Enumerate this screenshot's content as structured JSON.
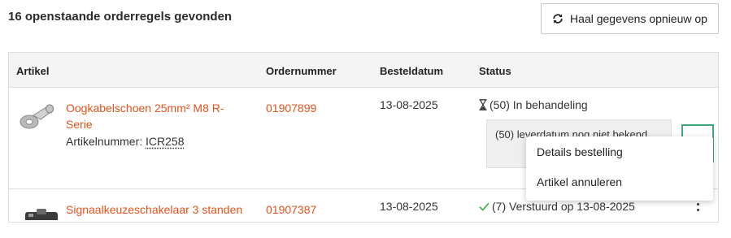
{
  "header": {
    "title": "16 openstaande orderregels gevonden",
    "refresh_label": "Haal gegevens opnieuw op"
  },
  "table": {
    "columns": [
      "Artikel",
      "Ordernummer",
      "Besteldatum",
      "Status"
    ],
    "rows": [
      {
        "product": "Oogkabelschoen 25mm² M8 R-Serie",
        "article_prefix": "Artikelnummer: ",
        "article_code": "ICR258",
        "order_number": "01907899",
        "order_date": "13-08-2025",
        "status": "(50) In behandeling",
        "status_icon": "hourglass-icon",
        "tooltip": "(50) leverdatum nog niet bekend"
      },
      {
        "product": "Signaalkeuzeschakelaar 3 standen",
        "order_number": "01907387",
        "order_date": "13-08-2025",
        "status": "(7) Verstuurd op 13-08-2025",
        "status_icon": "checkmark-icon",
        "status_icon_color": "#4caf50"
      }
    ]
  },
  "menu": {
    "items": [
      "Details bestelling",
      "Artikel annuleren"
    ]
  },
  "colors": {
    "link": "#e2531c",
    "focus_ring": "#3fa77a",
    "header_bg": "#f4f4f4"
  }
}
